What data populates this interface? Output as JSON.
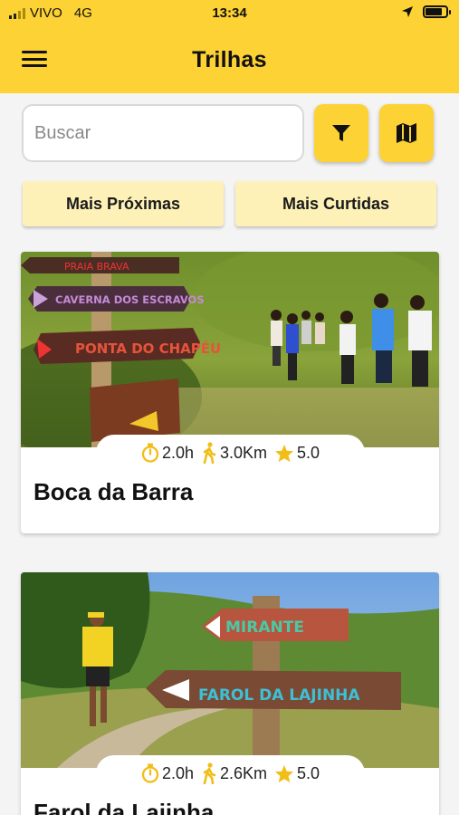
{
  "status_bar": {
    "carrier": "VIVO",
    "network": "4G",
    "time": "13:34"
  },
  "header": {
    "title": "Trilhas"
  },
  "search": {
    "placeholder": "Buscar",
    "value": ""
  },
  "sort_buttons": {
    "nearest_label": "Mais Próximas",
    "most_liked_label": "Mais Curtidas"
  },
  "trails": [
    {
      "name": "Boca da Barra",
      "duration": "2.0h",
      "distance": "3.0Km",
      "rating": "5.0",
      "sign_texts": [
        "PRAIA BRAVA",
        "CAVERNA DOS ESCRAVOS",
        "PONTA DO CHAPÉU"
      ]
    },
    {
      "name": "Farol da Lajinha",
      "duration": "2.0h",
      "distance": "2.6Km",
      "rating": "5.0",
      "sign_texts": [
        "MIRANTE",
        "FAROL DA LAJINHA"
      ]
    }
  ],
  "colors": {
    "brand_yellow": "#fdd234",
    "chip_yellow": "#fef1b8",
    "icon_yellow": "#f1be16"
  }
}
